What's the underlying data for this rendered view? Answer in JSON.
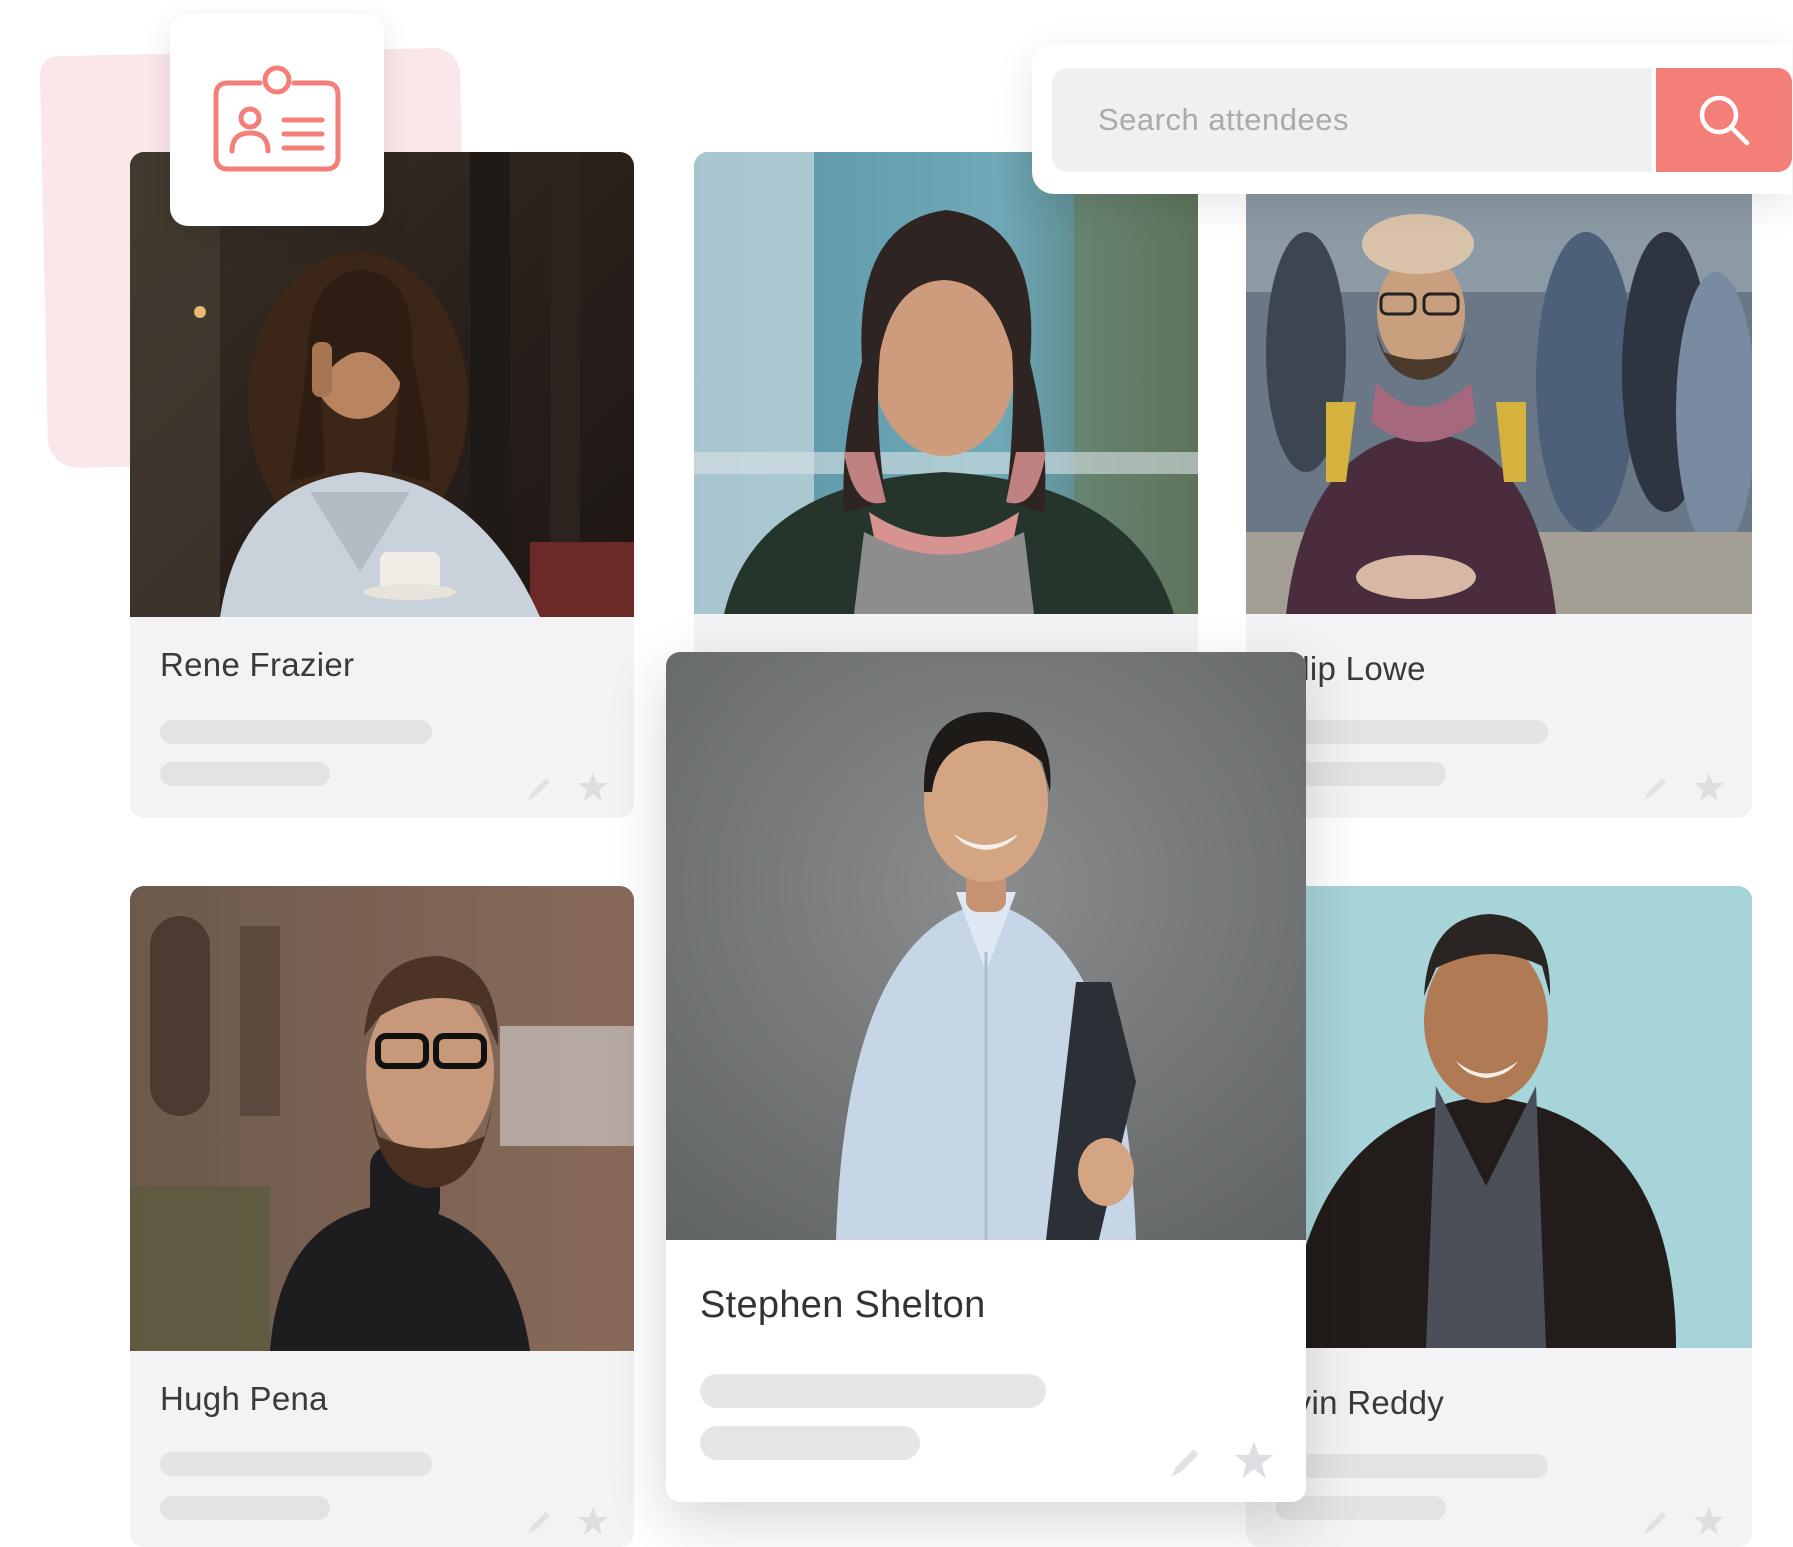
{
  "search": {
    "placeholder": "Search attendees"
  },
  "badge": {
    "icon": "id-badge-icon"
  },
  "attendees": [
    {
      "name": "Rene Frazier"
    },
    {
      "name": ""
    },
    {
      "name": "hilip Lowe"
    },
    {
      "name": "Hugh Pena"
    },
    {
      "name": "Stephen Shelton"
    },
    {
      "name": "avin Reddy"
    }
  ],
  "icons": {
    "edit": "pencil-icon",
    "favorite": "star-icon",
    "search": "search-icon"
  },
  "colors": {
    "accent": "#f47f79",
    "badge_pink": "#fbe6e9",
    "card_bg": "#f3f3f5",
    "skeleton": "#e3e3e6"
  }
}
